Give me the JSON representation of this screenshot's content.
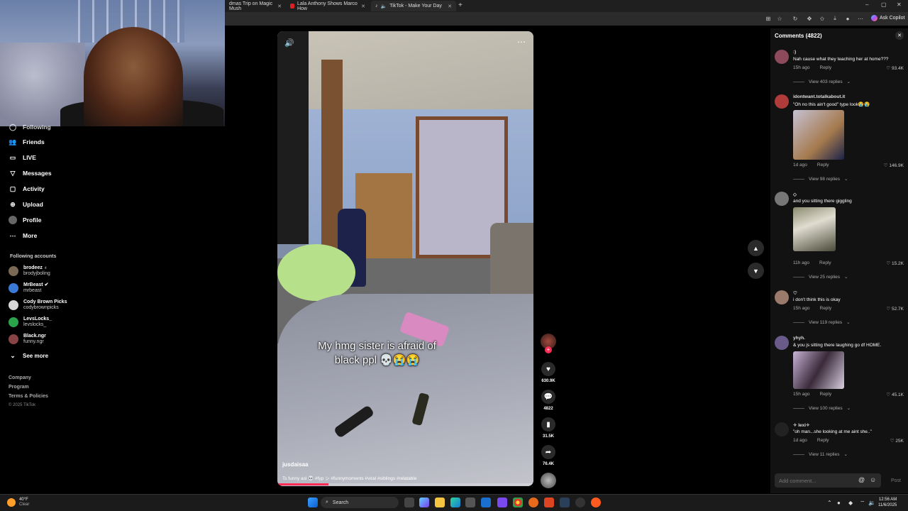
{
  "browser": {
    "tabs": [
      {
        "title": "dmas Trip on Magic Mush",
        "color": "#ff0000"
      },
      {
        "title": "Lala Anthony Shows Marco How",
        "color": "#ff0000"
      },
      {
        "title": "TikTok - Make Your Day",
        "color": "#ffffff"
      }
    ],
    "new_tab": "+",
    "copilot_label": "Ask Copilot",
    "window_controls": [
      "–",
      "▢",
      "✕"
    ]
  },
  "sidebar": {
    "nav": [
      {
        "label": "Following",
        "icon": "following-icon"
      },
      {
        "label": "Friends",
        "icon": "friends-icon"
      },
      {
        "label": "LIVE",
        "icon": "live-icon"
      },
      {
        "label": "Messages",
        "icon": "messages-icon"
      },
      {
        "label": "Activity",
        "icon": "activity-icon"
      },
      {
        "label": "Upload",
        "icon": "upload-icon"
      },
      {
        "label": "Profile",
        "icon": "profile-icon"
      },
      {
        "label": "More",
        "icon": "more-icon"
      }
    ],
    "following_title": "Following accounts",
    "accounts": [
      {
        "name": "brodeez ♁",
        "user": "brodyjboling",
        "color": "#7a6a55"
      },
      {
        "name": "MrBeast ✔",
        "user": "mrbeast",
        "color": "#3a7ad6"
      },
      {
        "name": "Cody Brown Picks",
        "user": "codybrownpicks",
        "color": "#d8d8d8"
      },
      {
        "name": "LevsLocks_",
        "user": "levslocks_",
        "color": "#2aa34a"
      },
      {
        "name": "Black.ngr",
        "user": "funny.ngr",
        "color": "#884444"
      }
    ],
    "see_more": "See more",
    "footer": [
      "Company",
      "Program",
      "Terms & Policies"
    ],
    "copyright": "© 2025 TikTok"
  },
  "video": {
    "caption_line1": "My hmg sister is afraid of",
    "caption_line2": "black ppl 💀😭😭",
    "author": "jusdaisaa",
    "description": "Ts funny asl 💀 #fyp シ #funnymoments #viral #siblings #relatable",
    "progress": 0.2
  },
  "actions": {
    "likes": "630.9K",
    "comments": "4822",
    "saves": "31.5K",
    "shares": "76.4K"
  },
  "comments_panel": {
    "title": "Comments (4822)",
    "input_placeholder": "Add comment...",
    "post_label": "Post",
    "items": [
      {
        "user": ":)",
        "text": "Nah cause what they teaching her at home???",
        "time": "15h ago",
        "reply": "Reply",
        "likes": "93.4K",
        "replies": "View 403 replies"
      },
      {
        "user": "idontwant.totalkabout.it",
        "text": "\"Oh no this ain't good\" type look😭😭",
        "time": "1d ago",
        "reply": "Reply",
        "likes": "146.9K",
        "replies": "View 98 replies"
      },
      {
        "user": "◇",
        "text": "and you sitting there giggling",
        "time": "11h ago",
        "reply": "Reply",
        "likes": "15.2K",
        "replies": "View 25 replies"
      },
      {
        "user": "♡",
        "text": "i don't think this is okay",
        "time": "15h ago",
        "reply": "Reply",
        "likes": "52.7K",
        "replies": "View 119 replies"
      },
      {
        "user": "yhyh.",
        "text": "& you js sitting there laughing go df HOME.",
        "time": "15h ago",
        "reply": "Reply",
        "likes": "45.1K",
        "replies": "View 100 replies"
      },
      {
        "user": "✧ lexi✧",
        "text": "\"oh man...she looking at me aint she..\"",
        "time": "1d ago",
        "reply": "Reply",
        "likes": "25K",
        "replies": "View 11 replies"
      }
    ]
  },
  "taskbar": {
    "temp": "40°F",
    "condition": "Clear",
    "search_label": "Search",
    "time": "12:56 AM",
    "date": "11/6/2025"
  }
}
